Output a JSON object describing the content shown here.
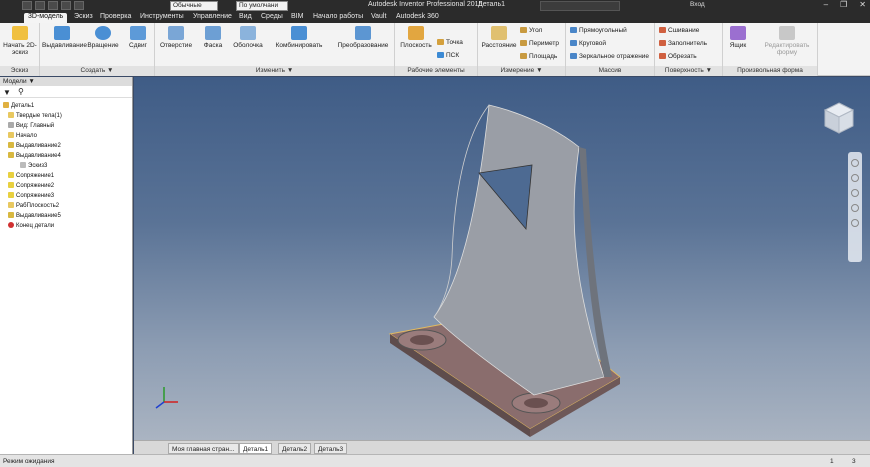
{
  "titlebar": {
    "app_title": "Autodesk Inventor Professional 2015",
    "doc_title": "Деталь1",
    "material_combo": "Обычные",
    "appearance_combo": "По умолчани",
    "signin": "Вход"
  },
  "tabs": [
    {
      "label": "3D-модель"
    },
    {
      "label": "Эскиз"
    },
    {
      "label": "Проверка"
    },
    {
      "label": "Инструменты"
    },
    {
      "label": "Управление"
    },
    {
      "label": "Вид"
    },
    {
      "label": "Среды"
    },
    {
      "label": "BIM"
    },
    {
      "label": "Начало работы"
    },
    {
      "label": "Vault"
    },
    {
      "label": "Autodesk 360"
    }
  ],
  "ribbon": {
    "panels": {
      "sketch": "Эскиз",
      "create": "Создать ▼",
      "modify": "Изменить ▼",
      "work": "Рабочие элементы",
      "measure": "Измерение ▼",
      "pattern": "Массив",
      "surface": "Поверхность ▼",
      "freeform": "Произвольная форма"
    },
    "buttons": {
      "start_sketch": "Начать 2D-эскиз",
      "extrude": "Выдавливание",
      "revolve": "Вращение",
      "sweep": "Сдвиг",
      "hole": "Отверстие",
      "chamfer": "Фаска",
      "shell": "Оболочка",
      "combine": "Комбинировать",
      "transform": "Преобразование",
      "plane": "Плоскость",
      "point": "Точка",
      "ucs": "ПСК",
      "distance": "Расстояние",
      "angle": "Угол",
      "perimeter": "Периметр",
      "area": "Площадь",
      "rectangular": "Прямоугольный",
      "circular": "Круговой",
      "mirror": "Зеркальное отражение",
      "stitch": "Сшивание",
      "patch": "Заполнитель",
      "trim": "Обрезать",
      "box": "Ящик",
      "edit_form": "Редактировать форму"
    }
  },
  "browser": {
    "header": "Модели ▼",
    "items": [
      "Деталь1",
      "Твердые тела(1)",
      "Вид: Главный",
      "Начало",
      "Выдавливание2",
      "Выдавливание4",
      "Эскиз3",
      "Сопряжение1",
      "Сопряжение2",
      "Сопряжение3",
      "РабПлоскость2",
      "Выдавливание5",
      "Конец детали"
    ]
  },
  "doc_tabs": [
    {
      "label": "Моя главная стран..."
    },
    {
      "label": "Деталь1"
    },
    {
      "label": "Деталь2"
    },
    {
      "label": "Деталь3"
    }
  ],
  "status": {
    "text": "Режим ожидания",
    "num1": "1",
    "num2": "3"
  }
}
